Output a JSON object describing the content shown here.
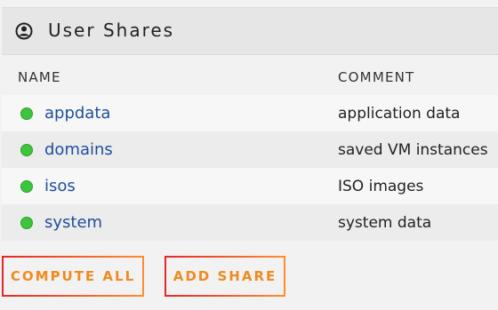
{
  "panel": {
    "title": "User Shares",
    "icon": "user-icon"
  },
  "columns": {
    "name": "NAME",
    "comment": "COMMENT"
  },
  "shares": [
    {
      "name": "appdata",
      "comment": "application data",
      "status": "online",
      "status_color": "#3ec43e"
    },
    {
      "name": "domains",
      "comment": "saved VM instances",
      "status": "online",
      "status_color": "#3ec43e"
    },
    {
      "name": "isos",
      "comment": "ISO images",
      "status": "online",
      "status_color": "#3ec43e"
    },
    {
      "name": "system",
      "comment": "system data",
      "status": "online",
      "status_color": "#3ec43e"
    }
  ],
  "buttons": {
    "compute_all": "COMPUTE ALL",
    "add_share": "ADD SHARE"
  },
  "colors": {
    "link": "#1f4e9c",
    "button_text": "#f08b1f",
    "button_border_start": "#e22828",
    "button_border_end": "#ff8c2f"
  }
}
